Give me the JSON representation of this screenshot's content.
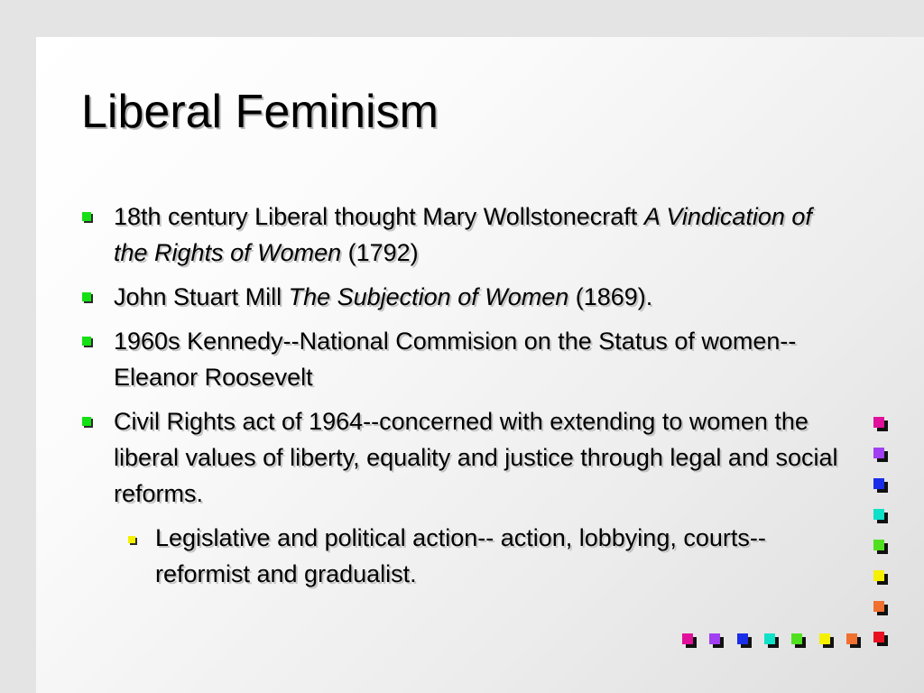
{
  "slide": {
    "title": "Liberal Feminism",
    "bullets": [
      {
        "parts": [
          {
            "text": "18th century Liberal thought Mary Wollstonecraft ",
            "italic": false
          },
          {
            "text": "A Vindication of the Rights of Women",
            "italic": true
          },
          {
            "text": " (1792)",
            "italic": false
          }
        ]
      },
      {
        "parts": [
          {
            "text": "John Stuart Mill ",
            "italic": false
          },
          {
            "text": "The Subjection of Women",
            "italic": true
          },
          {
            "text": " (1869).",
            "italic": false
          }
        ]
      },
      {
        "parts": [
          {
            "text": "1960s Kennedy--National Commision on the Status of women--Eleanor Roosevelt",
            "italic": false
          }
        ]
      },
      {
        "parts": [
          {
            "text": "Civil Rights act of 1964--concerned with extending to women the liberal values of liberty, equality and justice through legal and social reforms.",
            "italic": false
          }
        ]
      }
    ],
    "sub_bullet": "Legislative and political action-- action, lobbying, courts--reformist and gradualist."
  },
  "colors": {
    "bullet_marker": "#14e014",
    "sub_bullet_marker": "#f4f000",
    "decor_squares_vertical": [
      "#e0109a",
      "#a040f0",
      "#1a2ee8",
      "#10e0c8",
      "#50e020",
      "#f4f000",
      "#f07030",
      "#e81020"
    ],
    "decor_squares_horizontal": [
      "#e0109a",
      "#a040f0",
      "#1a2ee8",
      "#10e0c8",
      "#50e020",
      "#f4f000",
      "#f07030"
    ]
  }
}
